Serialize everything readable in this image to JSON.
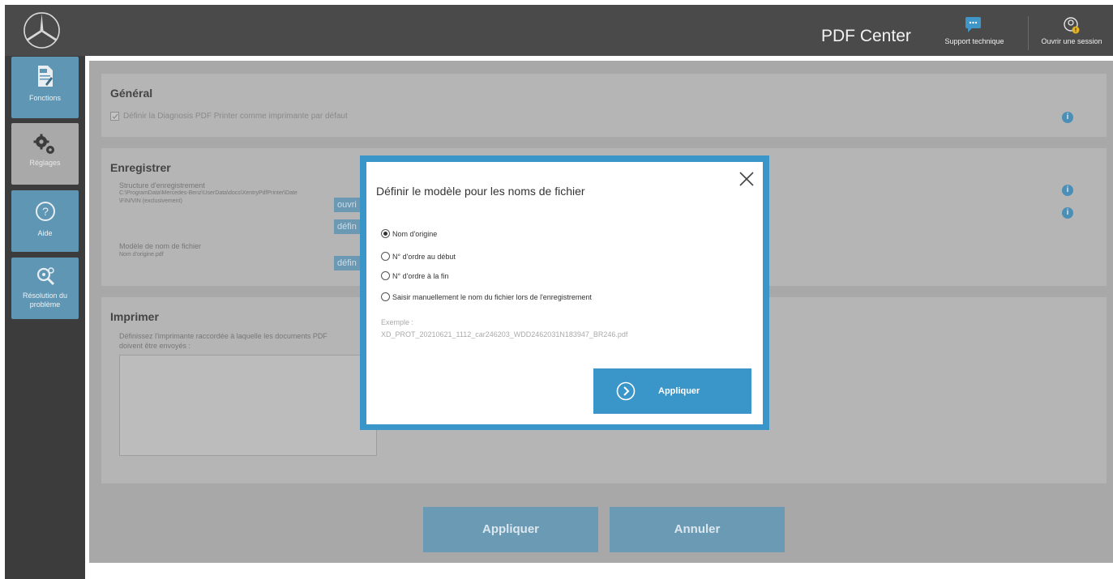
{
  "header": {
    "app_title": "PDF Center",
    "support_label": "Support technique",
    "session_label": "Ouvrir une session"
  },
  "sidebar": {
    "items": [
      {
        "label": "Fonctions",
        "icon": "pdf-document-icon",
        "active": true
      },
      {
        "label": "Réglages",
        "icon": "gears-icon",
        "active": false
      },
      {
        "label": "Aide",
        "icon": "question-icon",
        "active": true
      },
      {
        "label": "Résolution du problème",
        "icon": "gear-search-icon",
        "active": true
      }
    ]
  },
  "general": {
    "title": "Général",
    "checkbox_label": "Définir la Diagnosis PDF Printer comme imprimante par défaut",
    "checkbox_checked": true
  },
  "save": {
    "title": "Enregistrer",
    "structure_label": "Structure d'enregistrement",
    "structure_path_1": "C:\\ProgramData\\Mercedes-Benz\\UserData\\docs\\XentryPdfPrinter\\Date",
    "structure_path_2": "\\FIN/VIN (exclusivement)",
    "open_button": "ouvri",
    "define_button_1": "défin",
    "filename_label": "Modèle de nom de fichier",
    "filename_value": "Nom d'origine.pdf",
    "define_button_2": "défin"
  },
  "print": {
    "title": "Imprimer",
    "desc_1": "Définissez l'imprimante raccordée à laquelle les documents PDF",
    "desc_2": "doivent être envoyés :"
  },
  "footer": {
    "apply": "Appliquer",
    "cancel": "Annuler"
  },
  "modal": {
    "title": "Définir le modèle pour les noms de fichier",
    "options": [
      {
        "label": "Nom d'origine",
        "checked": true
      },
      {
        "label": "N° d'ordre au début",
        "checked": false
      },
      {
        "label": "N° d'ordre à la fin",
        "checked": false
      },
      {
        "label": "Saisir manuellement le nom du fichier lors de l'enregistrement",
        "checked": false
      }
    ],
    "example_label": "Exemple :",
    "example_value": "XD_PROT_20210621_1112_car246203_WDD2462031N183947_BR246.pdf",
    "apply": "Appliquer"
  },
  "colors": {
    "header_bg": "#4a4a4a",
    "sidebar_bg": "#3c3c3c",
    "accent_blue": "#3a95c9"
  }
}
